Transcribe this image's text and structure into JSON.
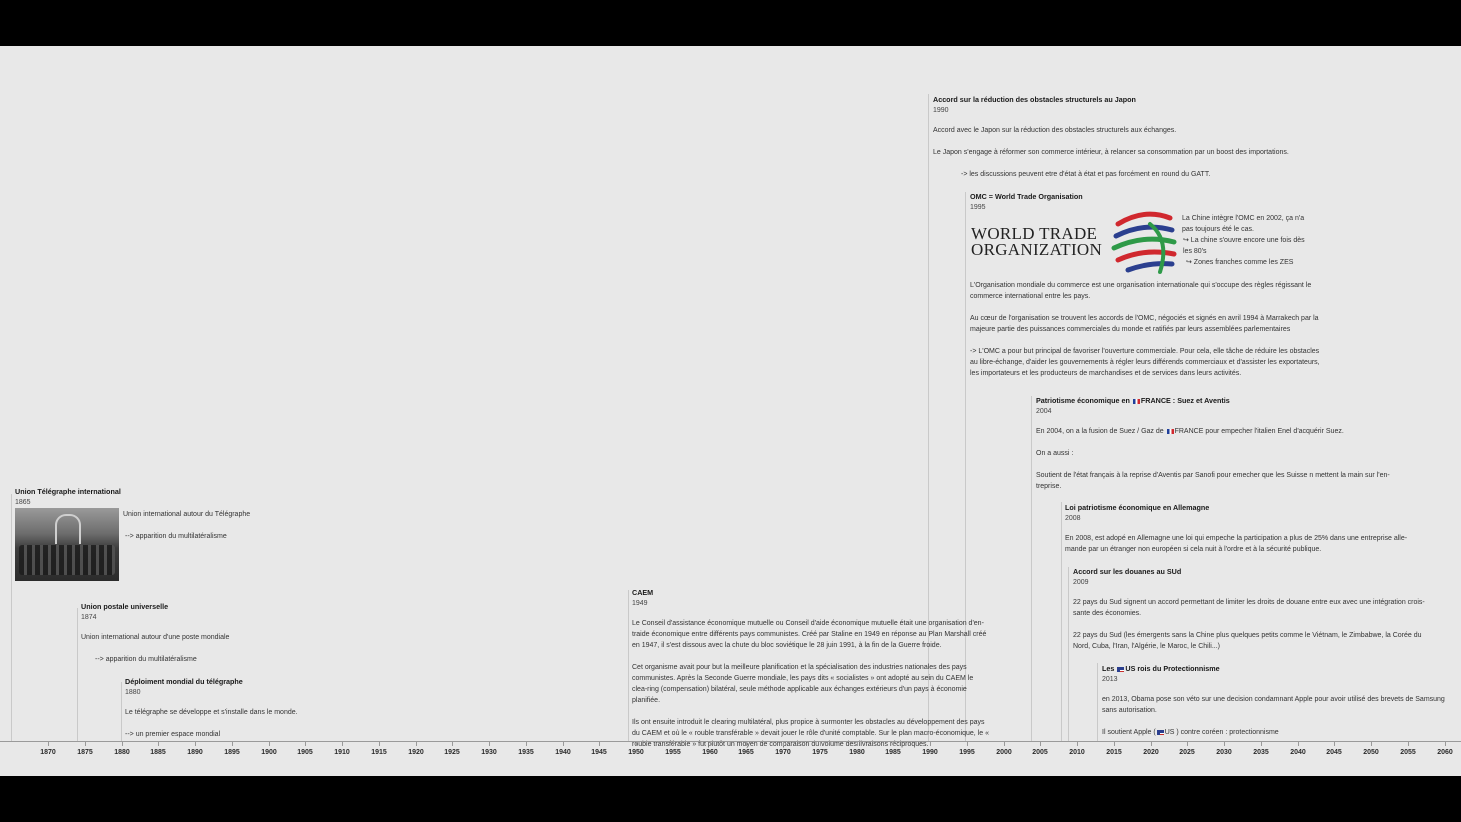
{
  "events": {
    "telegraph_union": {
      "title": "Union Télégraphe international",
      "year": "1865",
      "p1": "Union international autour du Télégraphe",
      "p2": "--> apparition du multilatéralisme"
    },
    "postal_union": {
      "title": "Union postale universelle",
      "year": "1874",
      "p1": "Union international autour d'une poste mondiale",
      "p2": "--> apparition du multilatéralisme"
    },
    "telegraph_deploy": {
      "title": "Déploiment mondial du télégraphe",
      "year": "1880",
      "p1": "Le télégraphe se développe et s'installe dans le monde.",
      "p2": "--> un premier espace mondial"
    },
    "caem": {
      "title": "CAEM",
      "year": "1949",
      "p1": "Le Conseil d'assistance économique mutuelle ou Conseil d'aide économique mutuelle était une organisation d'en-traide économique entre différents pays communistes. Créé par Staline en 1949 en réponse au Plan Marshall créé en 1947, il s'est dissous avec la chute du bloc soviétique le 28 juin 1991, à la fin de la Guerre froide.",
      "p2": "Cet organisme avait pour but la meilleure planification et la spécialisation des industries nationales des pays communistes. Après la Seconde Guerre mondiale, les pays dits « socialistes » ont adopté au sein du CAEM le clea-ring (compensation) bilatéral, seule méthode applicable aux échanges extérieurs d'un pays à économie planifiée.",
      "p3": "Ils ont ensuite introduit le clearing multilatéral, plus propice à surmonter les obstacles au développement des pays du CAEM et où le « rouble transférable » devait jouer le rôle d'unité comptable. Sur le plan macro-économique, le « rouble transférable » fut plutôt un moyen de comparaison du volume des livraisons réciproques."
    },
    "japan": {
      "title": "Accord sur la réduction des obstacles structurels au Japon",
      "year": "1990",
      "p1": "Accord avec le Japon sur la réduction des obstacles structurels aux échanges.",
      "p2": "Le Japon s'engage à réformer son commerce intérieur, à relancer sa consommation par un boost des importations.",
      "p3": "-> les discussions peuvent etre d'état à état et pas forcément en round du GATT."
    },
    "omc": {
      "title": "OMC = World Trade Organisation",
      "year": "1995",
      "logo_line1": "WORLD TRADE",
      "logo_line2": "ORGANIZATION",
      "side1": "La Chine intègre l'OMC en 2002, ça n'a pas toujours été le cas.",
      "side2": "↪ La chine s'ouvre encore une fois dès les 80's",
      "side3": "↪ Zones franches comme les ZES",
      "p1": "L'Organisation mondiale du commerce est une organisation internationale qui s'occupe des règles régissant le commerce international entre les pays.",
      "p2": "Au cœur de l'organisation se trouvent les accords de l'OMC, négociés et signés en avril 1994 à Marrakech par la majeure partie des puissances commerciales du monde et ratifiés par leurs assemblées parlementaires",
      "p3": "-> L'OMC a pour but principal de favoriser l'ouverture commerciale. Pour cela, elle tâche de réduire les obstacles au libre-échange, d'aider les gouvernements à régler leurs différends commerciaux et d'assister les exportateurs, les importateurs et les producteurs de marchandises et de services dans leurs activités."
    },
    "france": {
      "title_a": "Patriotisme économique en ",
      "title_b": "FRANCE : Suez et Aventis",
      "year": "2004",
      "p1a": "En 2004, on a la fusion de Suez / Gaz de ",
      "p1b": "FRANCE pour empecher l'italien Enel d'acquérir Suez.",
      "p2": "On a aussi :",
      "p3": "Soutient de l'état français à la reprise d'Aventis par Sanofi pour emecher que les Suisse n mettent la main sur l'en-treprise."
    },
    "germany": {
      "title": "Loi patriotisme économique en Allemagne",
      "year": "2008",
      "p1": "En 2008, est adopé en Allemagne une loi qui empeche la participation a plus de 25% dans une entreprise alle-mande par un étranger non européen si cela nuit à l'ordre et à la sécurité publique."
    },
    "south": {
      "title": "Accord sur les douanes au SUd",
      "year": "2009",
      "p1": "22 pays du Sud signent un accord permettant de limiter les droits de douane entre eux avec une intégration crois-sante des économies.",
      "p2": "22 pays du Sud (les émergents sans la Chine plus quelques petits comme le Viétnam, le Zimbabwe, la Corée du Nord, Cuba, l'Iran, l'Algérie, le Maroc, le Chili...)"
    },
    "us": {
      "title_a": "Les ",
      "title_b": "US rois du Protectionnisme",
      "year": "2013",
      "p1": "en 2013, Obama pose son véto sur une decision condamnant Apple pour avoir utilisé des brevets de Samsung sans autorisation.",
      "p2a": "Il soutient Apple (",
      "p2b": "US ) contre coréen : protectionnisme"
    }
  },
  "axis": {
    "years": [
      "1870",
      "1875",
      "1880",
      "1885",
      "1890",
      "1895",
      "1900",
      "1905",
      "1910",
      "1915",
      "1920",
      "1925",
      "1930",
      "1935",
      "1940",
      "1945",
      "1950",
      "1955",
      "1960",
      "1965",
      "1970",
      "1975",
      "1980",
      "1985",
      "1990",
      "1995",
      "2000",
      "2005",
      "2010",
      "2015",
      "2020",
      "2025",
      "2030",
      "2035",
      "2040",
      "2045",
      "2050",
      "2055",
      "2060"
    ]
  },
  "colors": {
    "background": "#e8e8e8",
    "letterbox": "#000000",
    "text": "#333333",
    "wto_red": "#d0282e",
    "wto_blue": "#2b3f8f",
    "wto_green": "#2e9a48"
  }
}
